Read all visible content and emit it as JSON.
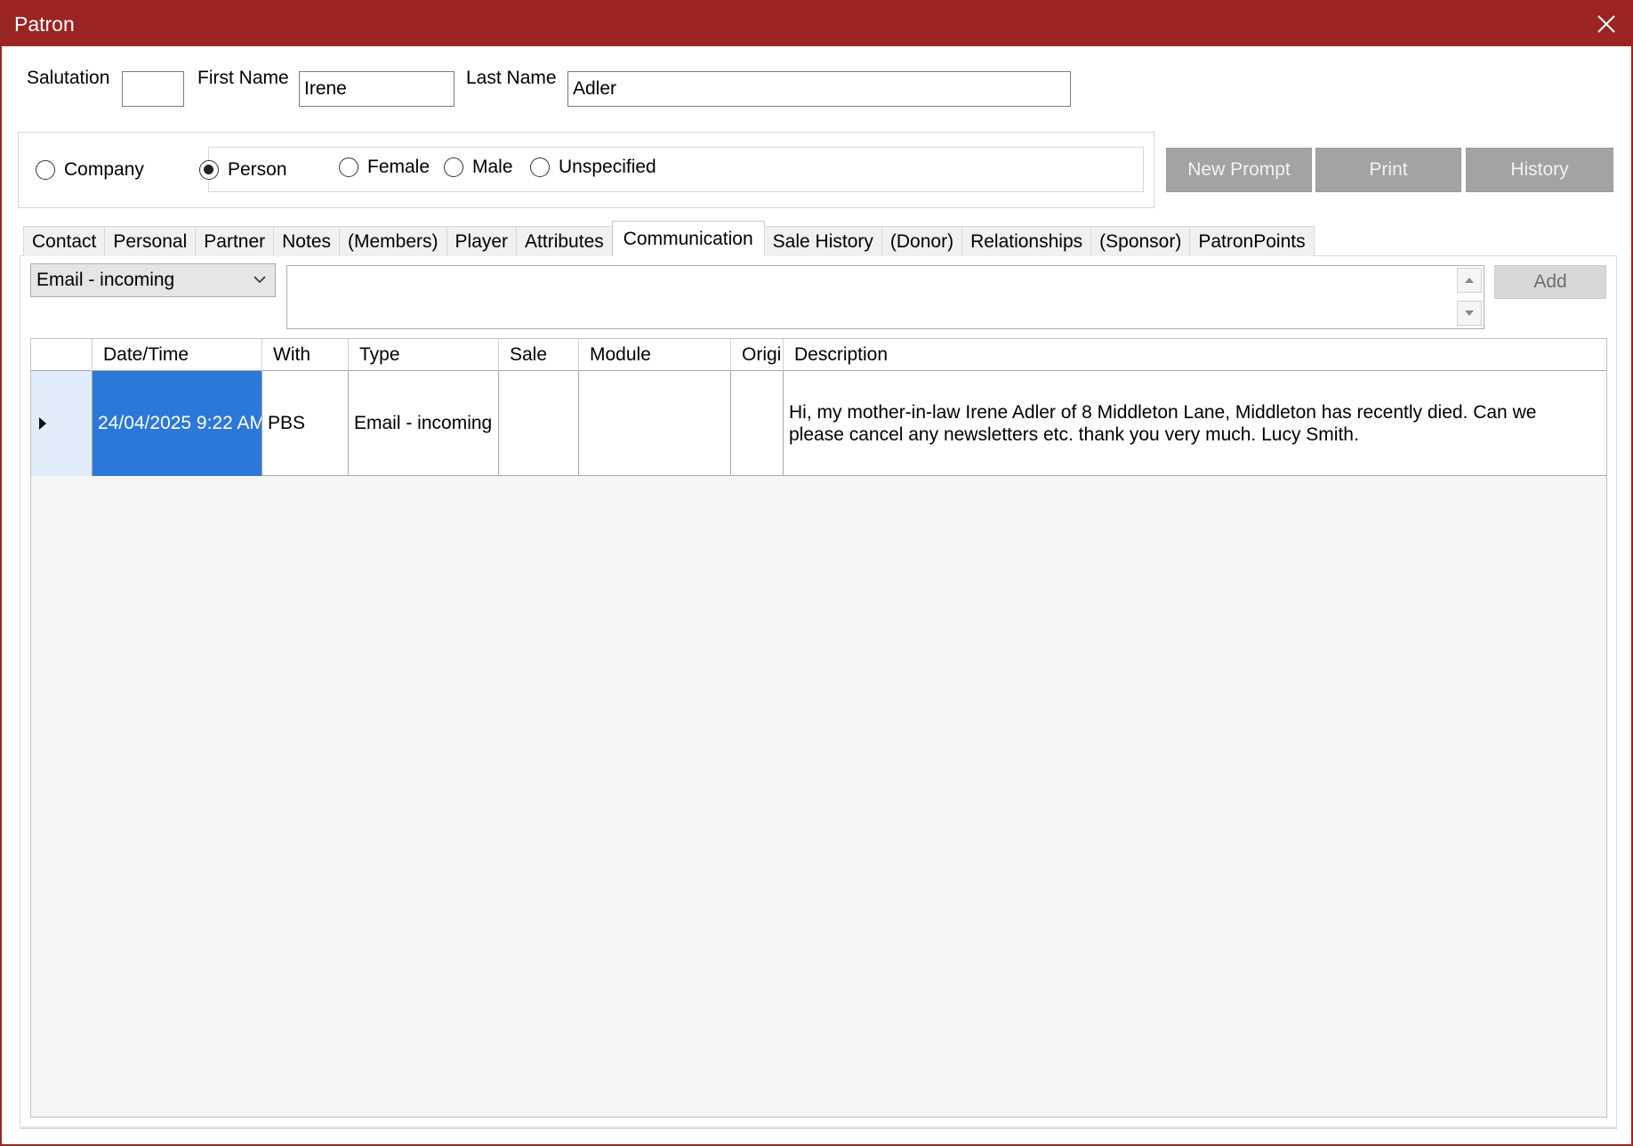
{
  "window": {
    "title": "Patron"
  },
  "name_fields": {
    "salutation_label": "Salutation",
    "salutation_value": "",
    "first_name_label": "First Name",
    "first_name_value": "Irene",
    "last_name_label": "Last Name",
    "last_name_value": "Adler"
  },
  "entity_type": {
    "company_label": "Company",
    "person_label": "Person",
    "selected": "Person"
  },
  "gender": {
    "female_label": "Female",
    "male_label": "Male",
    "unspecified_label": "Unspecified",
    "selected": ""
  },
  "actions": {
    "new_prompt": "New Prompt",
    "print": "Print",
    "history": "History"
  },
  "tabs": [
    {
      "label": "Contact"
    },
    {
      "label": "Personal"
    },
    {
      "label": "Partner"
    },
    {
      "label": "Notes"
    },
    {
      "label": "(Members)"
    },
    {
      "label": "Player"
    },
    {
      "label": "Attributes"
    },
    {
      "label": "Communication"
    },
    {
      "label": "Sale History"
    },
    {
      "label": "(Donor)"
    },
    {
      "label": "Relationships"
    },
    {
      "label": "(Sponsor)"
    },
    {
      "label": "PatronPoints"
    }
  ],
  "active_tab": "Communication",
  "communication": {
    "type_selected": "Email - incoming",
    "memo_value": "",
    "add_label": "Add",
    "columns": [
      "Date/Time",
      "With",
      "Type",
      "Sale",
      "Module",
      "Origi",
      "Description"
    ],
    "rows": [
      {
        "datetime": "24/04/2025 9:22 AM",
        "with": "PBS",
        "type": "Email - incoming",
        "sale": "",
        "module": "",
        "origin": "",
        "description": "Hi, my mother-in-law Irene Adler of 8 Middleton Lane, Middleton has recently died. Can we please cancel any newsletters etc. thank you very much. Lucy Smith."
      }
    ]
  },
  "colors": {
    "titlebar": "#9a2521",
    "selection": "#2b78d8",
    "action_button": "#a3a3a3"
  },
  "icons": {
    "close": "close-icon",
    "dropdown": "chevron-down-icon",
    "scroll_up": "scroll-up-icon",
    "scroll_down": "scroll-down-icon",
    "row_indicator": "row-pointer-icon"
  }
}
